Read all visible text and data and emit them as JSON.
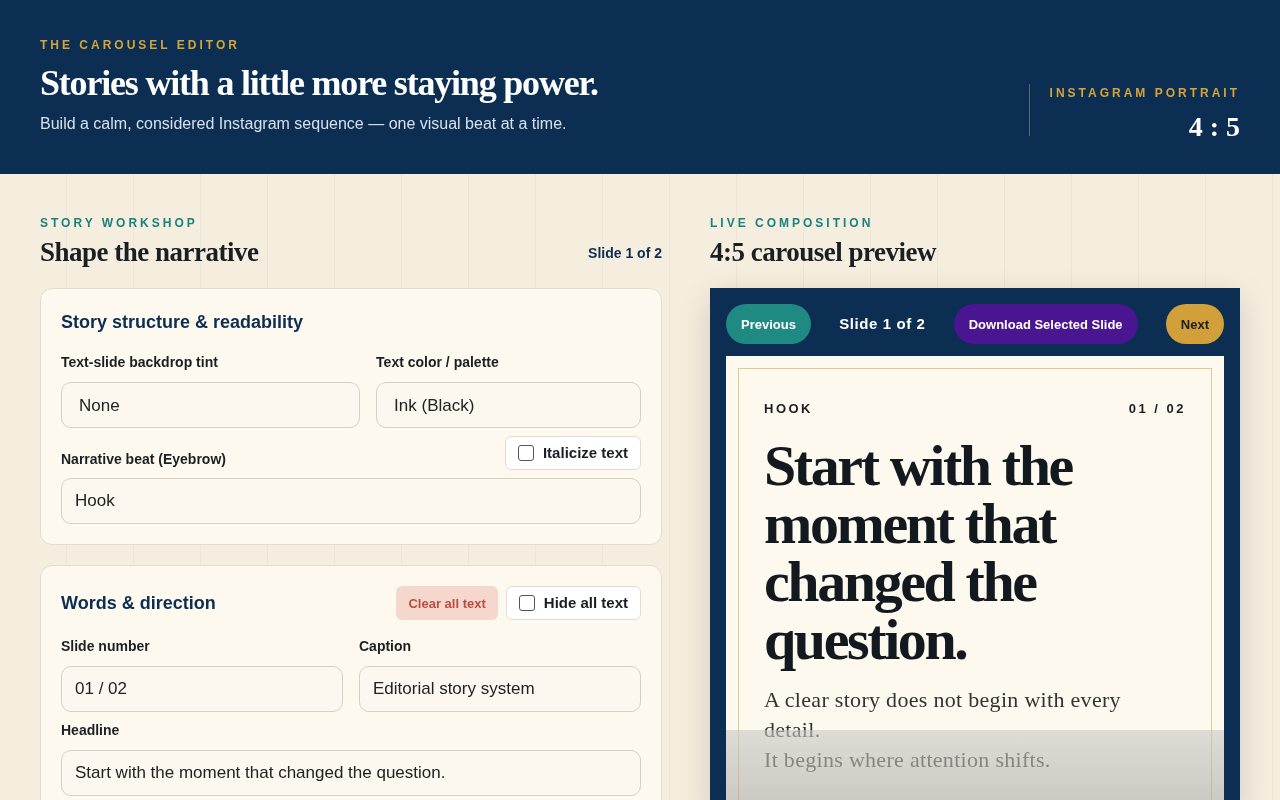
{
  "header": {
    "eyebrow": "THE CAROUSEL EDITOR",
    "title": "Stories with a little more staying power.",
    "subtitle": "Build a calm, considered Instagram sequence — one visual beat at a time.",
    "format_label": "INSTAGRAM PORTRAIT",
    "ratio": "4 : 5"
  },
  "workshop": {
    "eyebrow": "STORY WORKSHOP",
    "title": "Shape the narrative",
    "slide_indicator": "Slide 1 of 2",
    "cards": [
      {
        "title": "Story structure & readability",
        "rows": [
          [
            {
              "kind": "select",
              "label": "Text-slide backdrop tint",
              "value": "None"
            },
            {
              "kind": "select",
              "label": "Text color / palette",
              "value": "Ink (Black)"
            }
          ],
          [
            {
              "kind": "input",
              "label": "Narrative beat (Eyebrow)",
              "value": "Hook",
              "toggle": {
                "kind": "checkbox",
                "label": "Italicize text",
                "checked": false
              }
            }
          ]
        ]
      },
      {
        "title": "Words & direction",
        "actions": [
          {
            "kind": "button",
            "label": "Clear all text"
          },
          {
            "kind": "checkbox",
            "label": "Hide all text",
            "checked": false
          }
        ],
        "rows": [
          [
            {
              "kind": "input",
              "label": "Slide number",
              "value": "01 / 02"
            },
            {
              "kind": "input",
              "label": "Caption",
              "value": "Editorial story system"
            }
          ],
          [
            {
              "kind": "input",
              "label": "Headline",
              "value": "Start with the moment that changed the question."
            }
          ]
        ]
      }
    ]
  },
  "preview": {
    "eyebrow": "LIVE COMPOSITION",
    "title": "4:5 carousel preview",
    "controls": [
      {
        "kind": "previous",
        "label": "Previous"
      },
      {
        "kind": "indicator",
        "label": "Slide 1 of 2"
      },
      {
        "kind": "download",
        "label": "Download Selected Slide"
      },
      {
        "kind": "next",
        "label": "Next"
      }
    ],
    "slide": {
      "beat": "HOOK",
      "number": "01 / 02",
      "headline": "Start with the moment that changed the question.",
      "body": [
        "A clear story does not begin with every detail.",
        "It begins where attention shifts."
      ]
    }
  }
}
